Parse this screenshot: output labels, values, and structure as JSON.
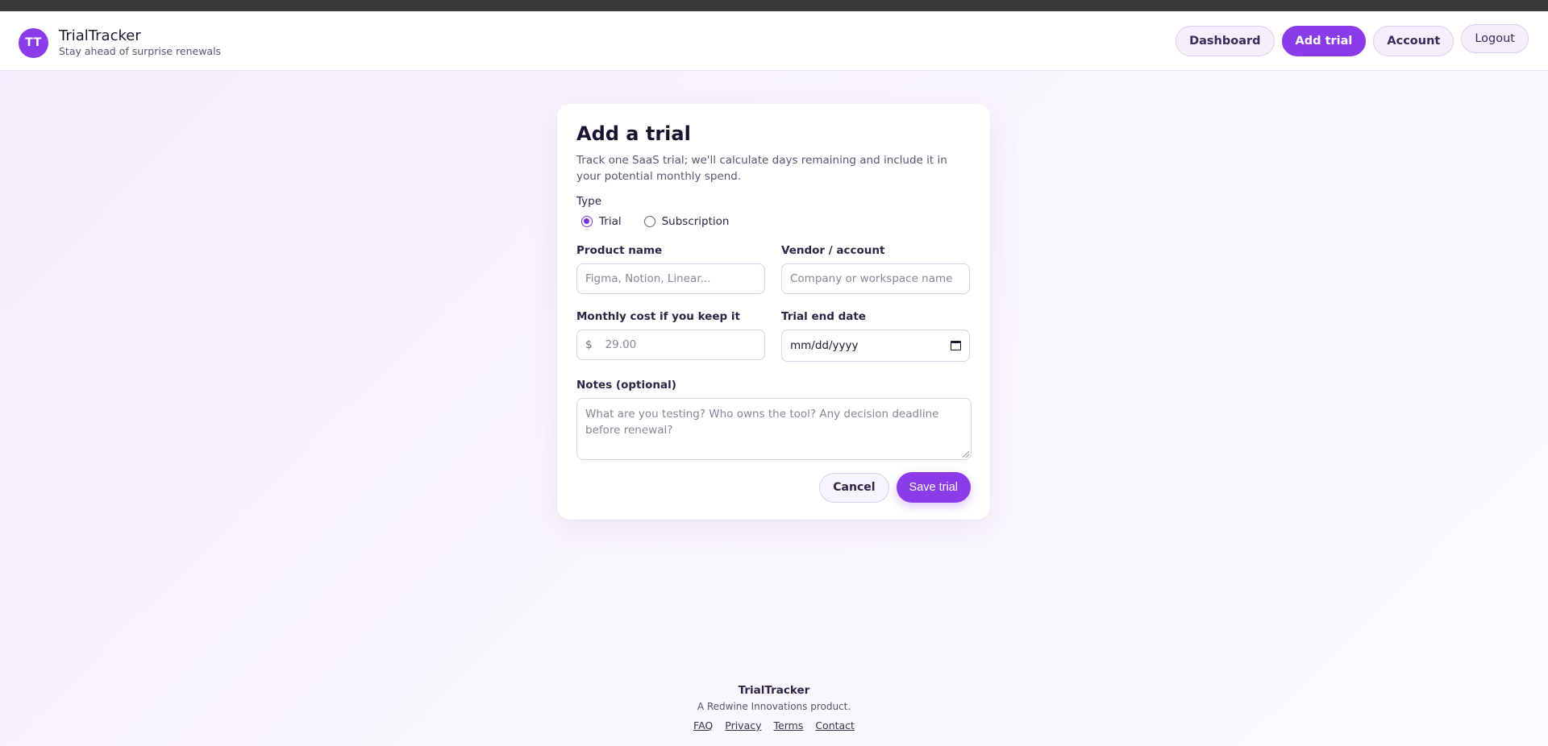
{
  "app": {
    "avatar_initials": "TT",
    "name": "TrialTracker",
    "tagline": "Stay ahead of surprise renewals"
  },
  "nav": {
    "dashboard": "Dashboard",
    "add_trial": "Add trial",
    "account": "Account",
    "logout": "Logout",
    "active": "add_trial"
  },
  "form": {
    "title": "Add a trial",
    "subtitle": "Track one SaaS trial; we'll calculate days remaining and include it in your potential monthly spend.",
    "type_label": "Type",
    "type_options": [
      {
        "label": "Trial",
        "checked": true
      },
      {
        "label": "Subscription",
        "checked": false
      }
    ],
    "product_name": {
      "label": "Product name",
      "placeholder": "Figma, Notion, Linear...",
      "value": ""
    },
    "vendor": {
      "label": "Vendor / account",
      "placeholder": "Company or workspace name",
      "value": ""
    },
    "monthly_cost": {
      "label": "Monthly cost if you keep it",
      "currency": "$",
      "placeholder": "29.00",
      "value": ""
    },
    "trial_end": {
      "label": "Trial end date",
      "placeholder": "mm/dd/yyyy",
      "value": ""
    },
    "notes": {
      "label": "Notes (optional)",
      "placeholder": "What are you testing? Who owns the tool? Any decision deadline before renewal?",
      "value": ""
    },
    "cancel_label": "Cancel",
    "save_label": "Save trial"
  },
  "footer": {
    "title": "TrialTracker",
    "subtitle": "A Redwine Innovations product.",
    "links": [
      "FAQ",
      "Privacy",
      "Terms",
      "Contact"
    ]
  },
  "colors": {
    "accent": "#8b3be8",
    "background": "#f5ecfd"
  }
}
